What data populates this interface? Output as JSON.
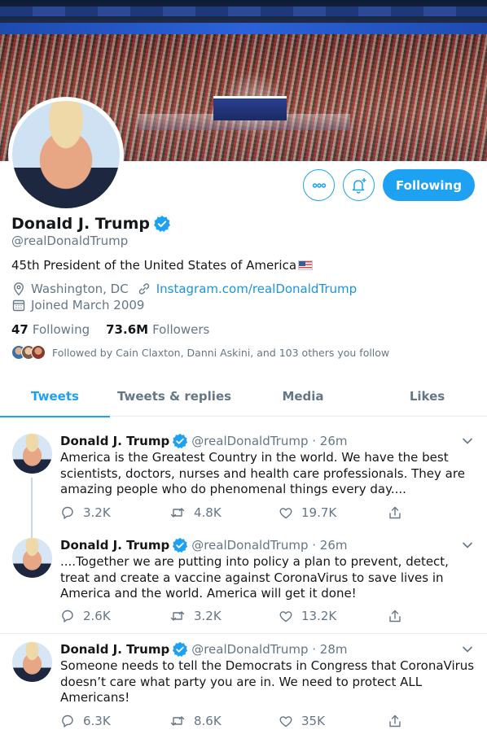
{
  "profile": {
    "name": "Donald J. Trump",
    "handle": "@realDonaldTrump",
    "bio": "45th President of the United States of America",
    "location": "Washington, DC",
    "website": "Instagram.com/realDonaldTrump",
    "joined": "Joined March 2009",
    "following_count": "47",
    "following_label": "Following",
    "followers_count": "73.6M",
    "followers_label": "Followers",
    "followed_by": "Followed by Cain Claxton, Danni Askini, and 103 others you follow"
  },
  "buttons": {
    "follow_label": "Following",
    "more_icon": "more-icon",
    "notify_icon": "bell-plus-icon"
  },
  "tabs": [
    {
      "label": "Tweets",
      "active": true
    },
    {
      "label": "Tweets & replies",
      "active": false
    },
    {
      "label": "Media",
      "active": false
    },
    {
      "label": "Likes",
      "active": false
    }
  ],
  "tweets": [
    {
      "name": "Donald J. Trump",
      "handle_time": "@realDonaldTrump · 26m",
      "text": "America is the Greatest Country in the world. We have the best scientists, doctors, nurses and health care professionals. They are amazing people who do phenomenal things every day....",
      "replies": "3.2K",
      "retweets": "4.8K",
      "likes": "19.7K"
    },
    {
      "name": "Donald J. Trump",
      "handle_time": "@realDonaldTrump · 26m",
      "text": "....Together we are putting into policy a plan to prevent, detect, treat and create a vaccine against CoronaVirus to save lives in America and the world. America will get it done!",
      "replies": "2.6K",
      "retweets": "3.2K",
      "likes": "13.2K"
    },
    {
      "name": "Donald J. Trump",
      "handle_time": "@realDonaldTrump · 28m",
      "text": "Someone needs to tell the Democrats in Congress that CoronaVirus doesn’t care what party you are in. We need to protect ALL Americans!",
      "replies": "6.3K",
      "retweets": "8.6K",
      "likes": "35K"
    }
  ],
  "colors": {
    "accent": "#1da1f2",
    "secondary_text": "#657786",
    "link": "#1b95e0"
  }
}
